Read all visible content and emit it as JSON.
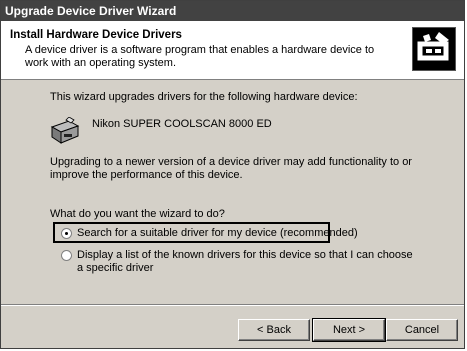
{
  "window": {
    "title": "Upgrade Device Driver Wizard"
  },
  "header": {
    "title": "Install Hardware Device Drivers",
    "description": "A device driver is a software program that enables a hardware device to work with an operating system.",
    "icon": "wizard-hardware-icon"
  },
  "body": {
    "intro": "This wizard upgrades drivers for the following hardware device:",
    "device_name": "Nikon SUPER COOLSCAN 8000 ED",
    "device_icon": "scanner-icon",
    "upgrade_note": "Upgrading to a newer version of a device driver may add functionality to or improve the performance of this device.",
    "question": "What do you want the wizard to do?",
    "options": [
      {
        "label": "Search for a suitable driver for my device (recommended)",
        "selected": true
      },
      {
        "label": "Display a list of the known drivers for this device so that I can choose a specific driver",
        "selected": false
      }
    ]
  },
  "buttons": {
    "back": "< Back",
    "next": "Next >",
    "cancel": "Cancel"
  }
}
